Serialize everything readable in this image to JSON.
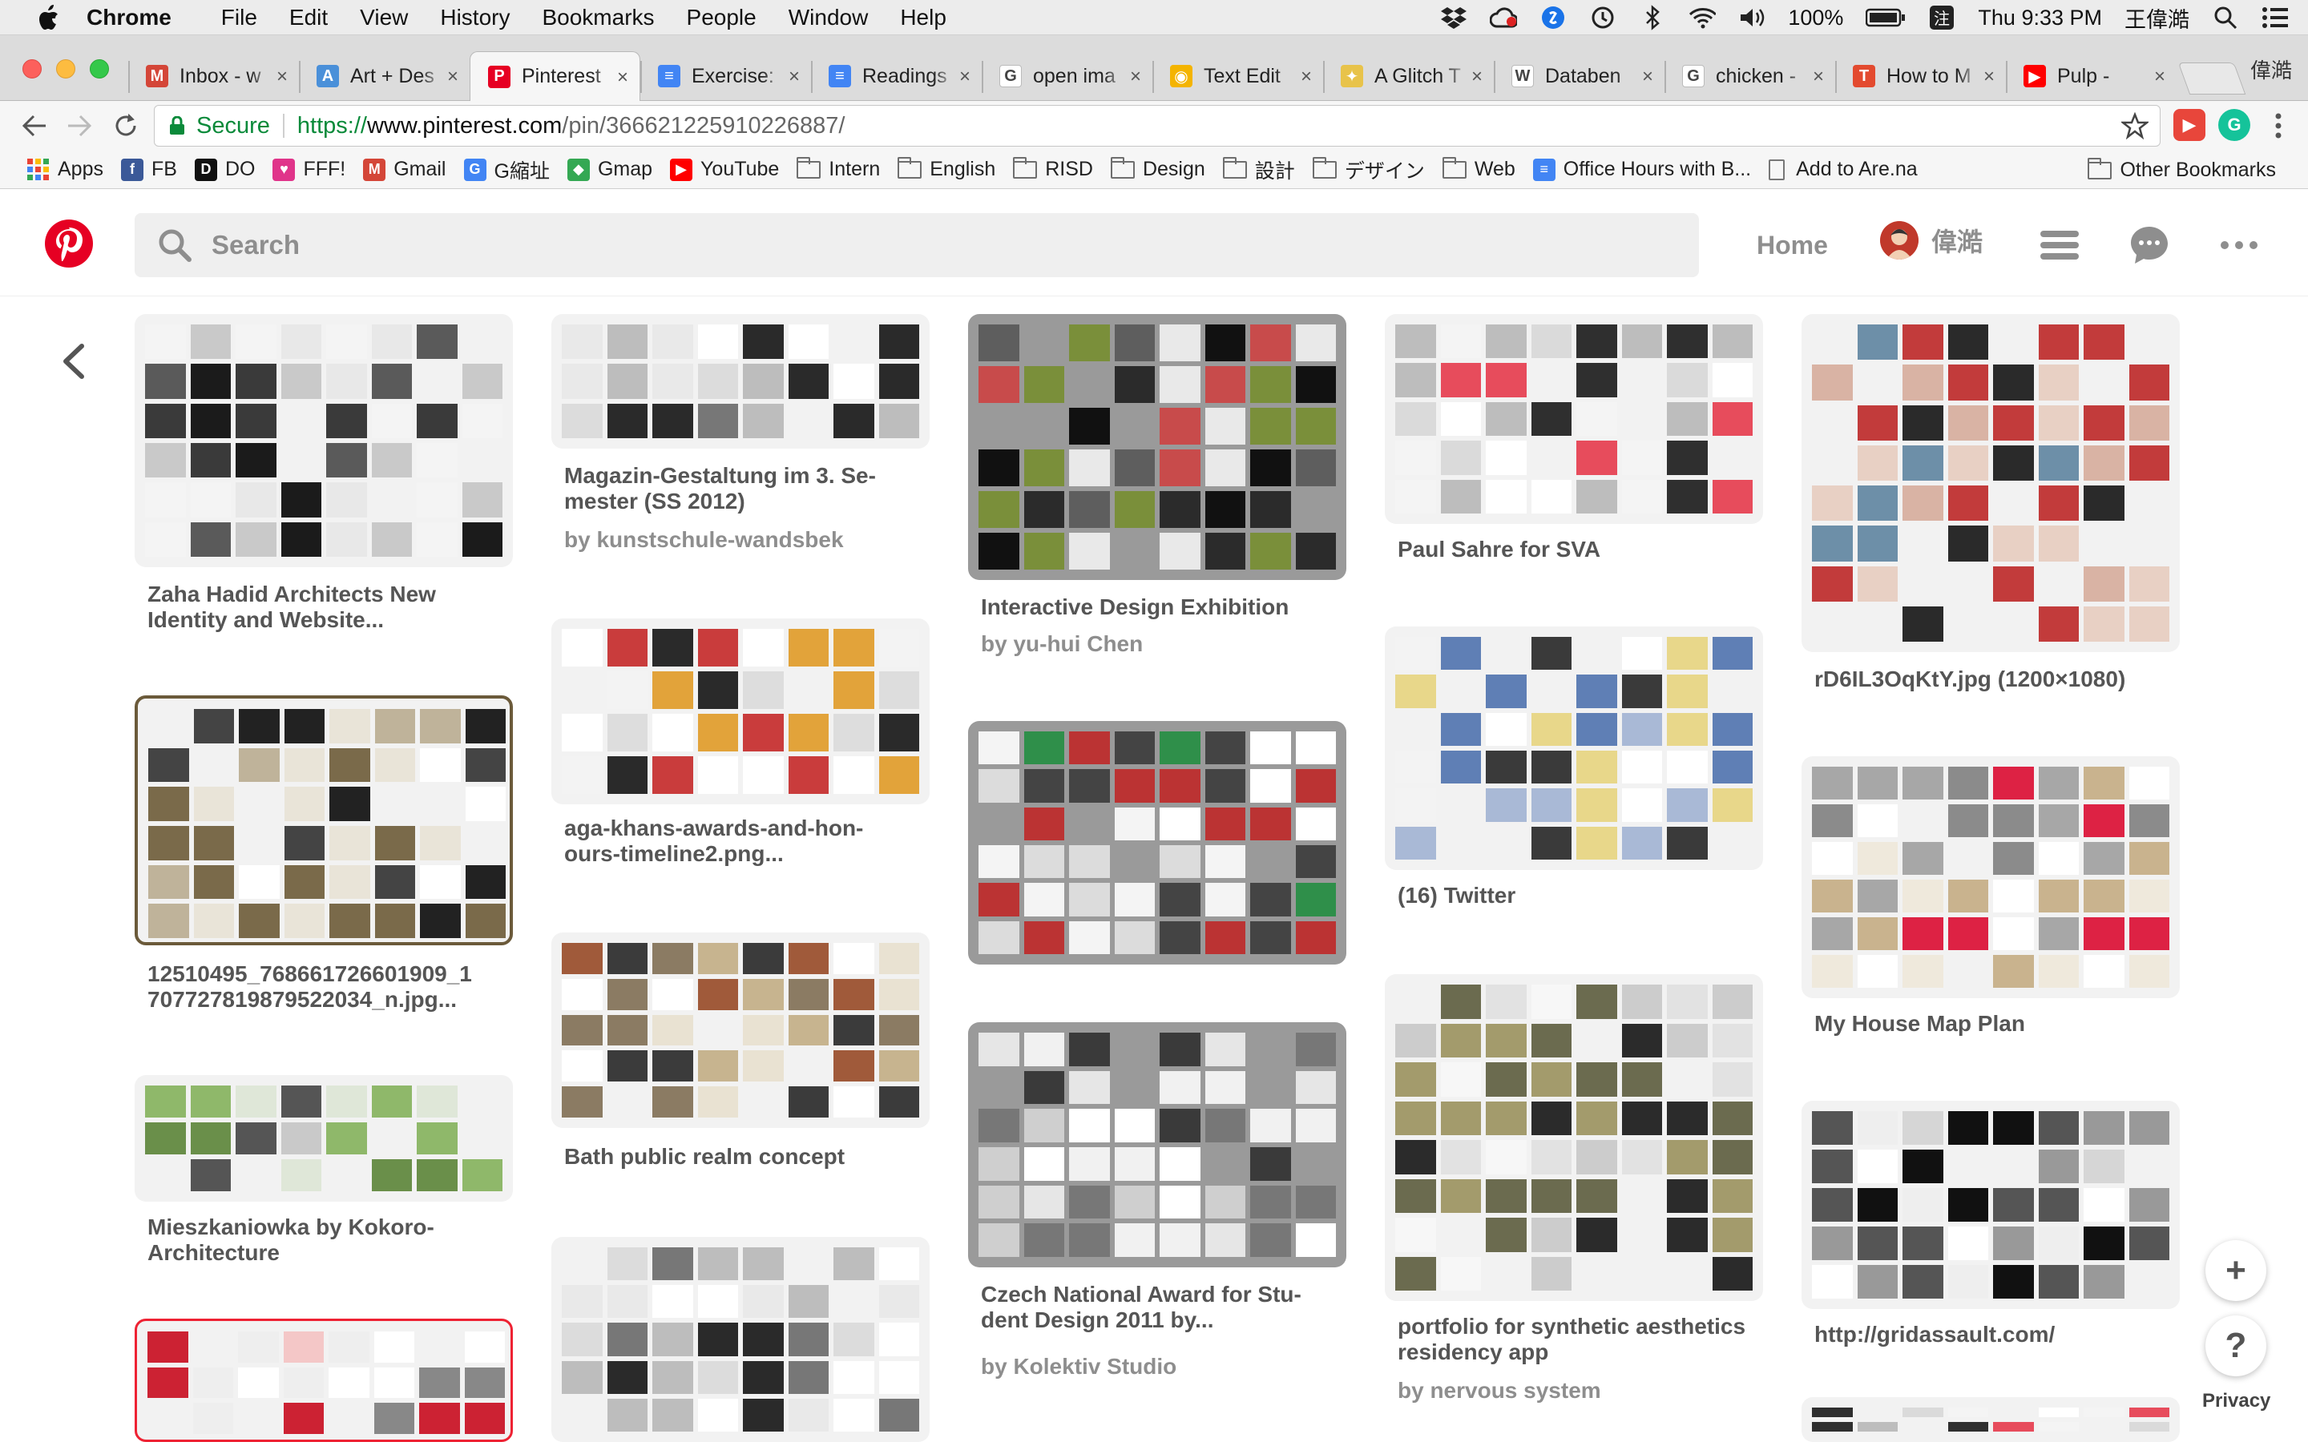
{
  "menubar": {
    "app": "Chrome",
    "items": [
      "File",
      "Edit",
      "View",
      "History",
      "Bookmarks",
      "People",
      "Window",
      "Help"
    ],
    "battery": "100%",
    "clock": "Thu 9:33 PM",
    "user": "王偉澔"
  },
  "tabs": [
    {
      "label": "Inbox - w",
      "icon": "gmail-icon",
      "color": "#d44638",
      "glyph": "M"
    },
    {
      "label": "Art + Des",
      "icon": "art-des-icon",
      "color": "#4a90d9",
      "glyph": "A"
    },
    {
      "label": "Pinterest",
      "icon": "pinterest-icon",
      "color": "#e60023",
      "glyph": "P",
      "active": true
    },
    {
      "label": "Exercise:",
      "icon": "docs-icon",
      "color": "#4285f4",
      "glyph": "≡"
    },
    {
      "label": "Readings",
      "icon": "docs-icon",
      "color": "#4285f4",
      "glyph": "≡"
    },
    {
      "label": "open ima",
      "icon": "google-icon",
      "color": "#ffffff",
      "glyph": "G"
    },
    {
      "label": "Text Edit",
      "icon": "chrome-icon",
      "color": "#f4b400",
      "glyph": "◉"
    },
    {
      "label": "A Glitch T",
      "icon": "glitch-icon",
      "color": "#e8c34a",
      "glyph": "✦"
    },
    {
      "label": "Databen",
      "icon": "wikipedia-icon",
      "color": "#ffffff",
      "glyph": "W"
    },
    {
      "label": "chicken -",
      "icon": "google-icon",
      "color": "#ffffff",
      "glyph": "G"
    },
    {
      "label": "How to M",
      "icon": "nytimes-icon",
      "color": "#e34a2f",
      "glyph": "T"
    },
    {
      "label": "Pulp -",
      "icon": "youtube-icon",
      "color": "#ff0000",
      "glyph": "▶"
    }
  ],
  "profile_label": "偉澔",
  "address": {
    "secure_label": "Secure",
    "scheme": "https://",
    "host": "www.pinterest.com",
    "path": "/pin/366621225910226887/"
  },
  "bookmarks": [
    {
      "label": "Apps",
      "type": "apps"
    },
    {
      "label": "FB",
      "type": "icon",
      "color": "#3b5998",
      "glyph": "f"
    },
    {
      "label": "DO",
      "type": "icon",
      "color": "#111111",
      "glyph": "D"
    },
    {
      "label": "FFF!",
      "type": "icon",
      "color": "#e0348a",
      "glyph": "♥"
    },
    {
      "label": "Gmail",
      "type": "icon",
      "color": "#d44638",
      "glyph": "M"
    },
    {
      "label": "G縮址",
      "type": "icon",
      "color": "#4285f4",
      "glyph": "G"
    },
    {
      "label": "Gmap",
      "type": "icon",
      "color": "#34a853",
      "glyph": "◆"
    },
    {
      "label": "YouTube",
      "type": "icon",
      "color": "#ff0000",
      "glyph": "▶"
    },
    {
      "label": "Intern",
      "type": "folder"
    },
    {
      "label": "English",
      "type": "folder"
    },
    {
      "label": "RISD",
      "type": "folder"
    },
    {
      "label": "Design",
      "type": "folder"
    },
    {
      "label": "設計",
      "type": "folder"
    },
    {
      "label": "デザイン",
      "type": "folder"
    },
    {
      "label": "Web",
      "type": "folder"
    },
    {
      "label": "Office Hours with B...",
      "type": "icon",
      "color": "#4285f4",
      "glyph": "≡"
    },
    {
      "label": "Add to Are.na",
      "type": "page"
    }
  ],
  "other_bookmarks": "Other Bookmarks",
  "pinterest": {
    "search_placeholder": "Search",
    "home": "Home",
    "user": "偉澔",
    "brand_color": "#e60023"
  },
  "pins": [
    {
      "title": "Zaha Hadid Architects New\nIdentity and Website...",
      "by": "",
      "tone": "dark"
    },
    {
      "title": "12510495_768661726601909_1\n707727819879522034_n.jpg...",
      "by": "",
      "tone": "brown"
    },
    {
      "title": "Mieszkaniowka by Kokoro-\nArchitecture",
      "by": "",
      "tone": "green"
    },
    {
      "title": "",
      "by": "",
      "tone": "red"
    },
    {
      "title": "Magazin-Gestaltung im 3. Se-\nmester (SS 2012)",
      "by": "by kunstschule-wandsbek",
      "tone": "mono"
    },
    {
      "title": "aga-khans-awards-and-hon-\nours-timeline2.png...",
      "by": "",
      "tone": "timeline"
    },
    {
      "title": "Bath public realm concept",
      "by": "",
      "tone": "earth"
    },
    {
      "title": "",
      "by": "",
      "tone": "mono"
    },
    {
      "title": "Interactive Design Exhibition",
      "by": "by yu-hui Chen",
      "tone": "gallery"
    },
    {
      "title": "",
      "by": "",
      "tone": "greenbook"
    },
    {
      "title": "Czech National Award for Stu-\ndent Design 2011 by...",
      "by": "by Kolektiv Studio",
      "tone": "book"
    },
    {
      "title": "Paul Sahre for SVA",
      "by": "",
      "tone": "light"
    },
    {
      "title": "(16) Twitter",
      "by": "",
      "tone": "blueyellow"
    },
    {
      "title": "portfolio for synthetic aesthetics\nresidency app",
      "by": "by nervous system",
      "tone": "nature"
    },
    {
      "title": "rD6IL3OqKtY.jpg (1200×1080)",
      "by": "",
      "tone": "pixel"
    },
    {
      "title": "My House Map Plan",
      "by": "",
      "tone": "plan"
    },
    {
      "title": "http://gridassault.com/",
      "by": "",
      "tone": "web"
    },
    {
      "title": "",
      "by": "",
      "tone": "light"
    }
  ],
  "fab": {
    "add": "+",
    "help": "?"
  },
  "privacy": "Privacy"
}
